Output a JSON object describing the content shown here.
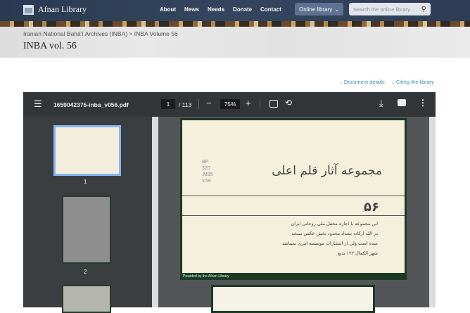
{
  "header": {
    "logo": "Afnan Library",
    "nav": [
      "About",
      "News",
      "Needs",
      "Donate",
      "Contact"
    ],
    "online_library": "Online library",
    "search_placeholder": "Search the online library..."
  },
  "breadcrumb": "Iranian National Bahá'í Archives (INBA) > INBA Volume 56",
  "title": "INBA vol. 56",
  "links": {
    "details": "Document details",
    "citing": "Citing the library"
  },
  "viewer": {
    "filename": "1659042375-inba_v056.pdf",
    "page": "1",
    "total": "/ 113",
    "zoom": "75%",
    "thumb_labels": [
      "1",
      "2"
    ]
  },
  "page1": {
    "call_number": [
      "BP",
      "320",
      ".M35",
      "v.56"
    ],
    "heading": "مجموعه آثار قلم اعلی",
    "number": "۵۶",
    "body": [
      "این مجموعه با اجازه محفل ملی روحانی ایران",
      "در الله ارکانه بتعداد محدود بخش عکس نسخه",
      "شده است ولی از انتشارات موسسه امری نمیباشد",
      "شهر الکمال ۱۲۲ بدیع"
    ],
    "footer": "Provided by the Afnan Library"
  }
}
